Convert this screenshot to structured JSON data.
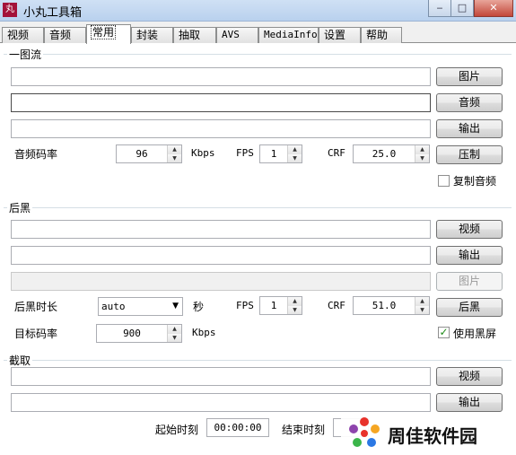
{
  "window": {
    "title": "小丸工具箱",
    "icon": "丸"
  },
  "tabs": [
    {
      "label": "视频"
    },
    {
      "label": "音频"
    },
    {
      "label": "常用",
      "active": true
    },
    {
      "label": "封装"
    },
    {
      "label": "抽取"
    },
    {
      "label": "AVS"
    },
    {
      "label": "MediaInfo"
    },
    {
      "label": "设置"
    },
    {
      "label": "帮助"
    }
  ],
  "group1": {
    "title": "一图流",
    "image_button": "图片",
    "audio_button": "音频",
    "output_button": "输出",
    "audio_bitrate_label": "音频码率",
    "audio_bitrate_value": "96",
    "kbps_unit": "Kbps",
    "fps_label": "FPS",
    "fps_value": "1",
    "crf_label": "CRF",
    "crf_value": "25.0",
    "compress_button": "压制",
    "copy_audio_label": "复制音频",
    "copy_audio_checked": false
  },
  "group2": {
    "title": "后黑",
    "video_button": "视频",
    "output_button": "输出",
    "image_button": "图片",
    "duration_label": "后黑时长",
    "duration_value": "auto",
    "seconds_unit": "秒",
    "fps_label": "FPS",
    "fps_value": "1",
    "crf_label": "CRF",
    "crf_value": "51.0",
    "black_button": "后黑",
    "target_bitrate_label": "目标码率",
    "target_bitrate_value": "900",
    "kbps_unit": "Kbps",
    "use_black_label": "使用黑屏",
    "use_black_checked": true
  },
  "group3": {
    "title": "截取",
    "video_button": "视频",
    "output_button": "输出",
    "start_time_label": "起始时刻",
    "start_time_value": "00:00:00",
    "end_time_label": "结束时刻"
  },
  "watermark": {
    "text": "周佳软件园"
  }
}
